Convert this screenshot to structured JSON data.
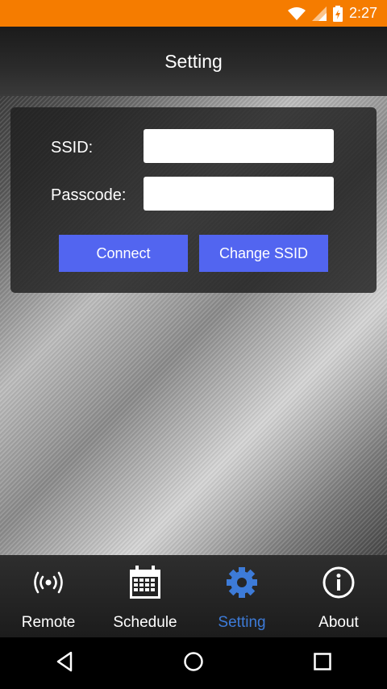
{
  "status_bar": {
    "time": "2:27"
  },
  "header": {
    "title": "Setting"
  },
  "form": {
    "ssid_label": "SSID:",
    "ssid_value": "",
    "passcode_label": "Passcode:",
    "passcode_value": "",
    "connect_label": "Connect",
    "change_ssid_label": "Change SSID"
  },
  "bottom_nav": {
    "items": [
      {
        "label": "Remote",
        "icon": "wireless-signal-icon",
        "active": false
      },
      {
        "label": "Schedule",
        "icon": "calendar-icon",
        "active": false
      },
      {
        "label": "Setting",
        "icon": "gear-icon",
        "active": true
      },
      {
        "label": "About",
        "icon": "info-icon",
        "active": false
      }
    ]
  },
  "colors": {
    "status_bar": "#f57c00",
    "button": "#5265f0",
    "active_nav": "#3d7bd8"
  }
}
